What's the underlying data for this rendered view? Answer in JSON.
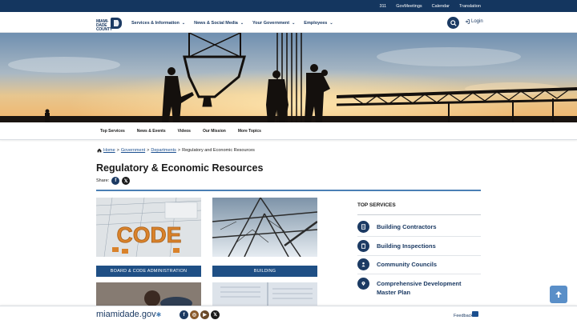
{
  "topbar": {
    "links": [
      "311",
      "GovMeetings",
      "Calendar",
      "Translation"
    ]
  },
  "header": {
    "logo_text": "MIAMI-DADE COUNTY",
    "nav": [
      {
        "label": "Services & Information"
      },
      {
        "label": "News & Social Media"
      },
      {
        "label": "Your Government"
      },
      {
        "label": "Employees"
      }
    ],
    "login_label": "Login"
  },
  "subnav": {
    "items": [
      "Top Services",
      "News & Events",
      "Videos",
      "Our Mission",
      "More Topics"
    ]
  },
  "breadcrumb": {
    "home": "Home",
    "sep": ">",
    "government": "Government",
    "departments": "Departments",
    "current": "Regulatory and Economic Resources"
  },
  "page": {
    "title": "Regulatory & Economic Resources",
    "share_label": "Share:"
  },
  "cards": [
    {
      "label": "BOARD & CODE ADMINISTRATION",
      "image_text": "CODE"
    },
    {
      "label": "BUILDING"
    }
  ],
  "top_services": {
    "title": "TOP SERVICES",
    "items": [
      {
        "label": "Building Contractors",
        "icon": "document-icon"
      },
      {
        "label": "Building Inspections",
        "icon": "clipboard-icon"
      },
      {
        "label": "Community Councils",
        "icon": "people-icon"
      },
      {
        "label": "Comprehensive Development Master Plan",
        "icon": "location-pin-icon"
      }
    ]
  },
  "footer": {
    "brand": "miamidade.gov",
    "feedback_label": "Feedback"
  },
  "colors": {
    "navy": "#14365f",
    "link_blue": "#1b3a63",
    "button_blue": "#1f4f85",
    "accent_rule": "#4a7fb5"
  }
}
